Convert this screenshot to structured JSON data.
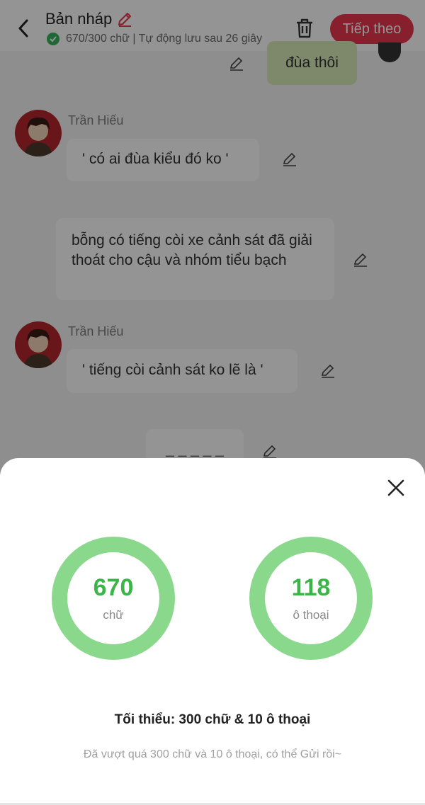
{
  "header": {
    "title": "Bản nháp",
    "status": "670/300 chữ | Tự động lưu sau 26 giây",
    "next_label": "Tiếp theo",
    "accent_color": "#e8364f"
  },
  "chat": {
    "bubble_top": "đùa thôi",
    "msg1": {
      "name": "Trần Hiếu",
      "text": "' có ai đùa kiểu đó ko '"
    },
    "narration": "bỗng có tiếng còi xe cảnh sát đã giải thoát cho cậu và nhóm tiểu bạch",
    "msg2": {
      "name": "Trần Hiếu",
      "text": "' tiếng còi cảnh sát ko lẽ là '"
    },
    "separator": "_ _ _ _ _"
  },
  "sheet": {
    "words_value": "670",
    "words_label": "chữ",
    "dialogs_value": "118",
    "dialogs_label": "ô thoại",
    "minimum": "Tối thiểu: 300 chữ & 10 ô thoại",
    "hint": "Đã vượt quá 300 chữ và 10 ô thoại, có thể Gửi rồi~",
    "ring_color": "#8ad88b",
    "value_color": "#3cb548"
  },
  "icons": [
    "back-icon",
    "pencil-icon",
    "check-icon",
    "trash-icon",
    "edit-icon",
    "close-icon"
  ]
}
